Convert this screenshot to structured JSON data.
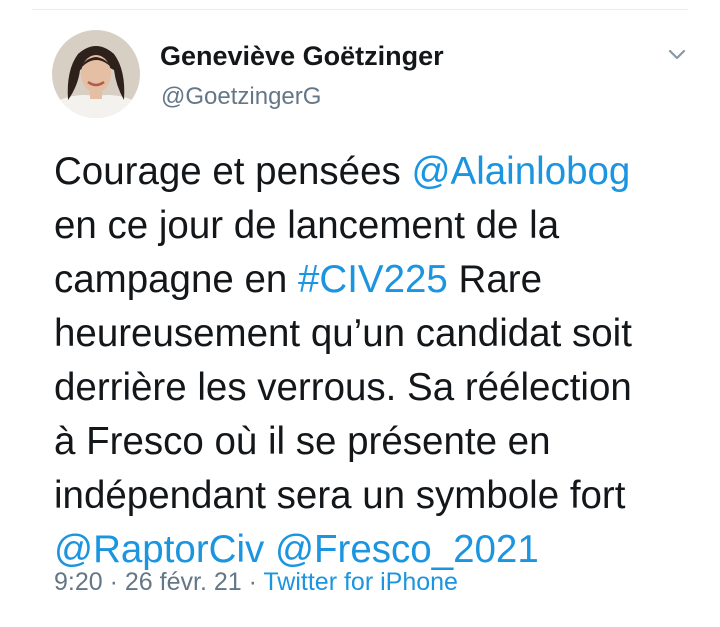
{
  "author": {
    "display_name": "Geneviève Goëtzinger",
    "handle": "@GoetzingerG"
  },
  "tweet": {
    "line1": {
      "text": "Courage et pensées ",
      "mention": "@Alainlobog"
    },
    "line2": {
      "text": "en ce jour de lancement de la"
    },
    "line3": {
      "text_before": "campagne en ",
      "hashtag": "#CIV225",
      "text_after": " Rare"
    },
    "line4": {
      "text": "heureusement qu’un candidat soit"
    },
    "line5": {
      "text": "derrière les verrous. Sa réélection"
    },
    "line6": {
      "text": "à Fresco où il se présente en"
    },
    "line7": {
      "text": "indépendant sera un symbole fort"
    },
    "line8": {
      "mention1": "@RaptorCiv",
      "space": " ",
      "mention2": "@Fresco_2021"
    }
  },
  "meta": {
    "time": "9:20",
    "sep1": " · ",
    "date": "26 févr. 21",
    "sep2": " · ",
    "source": "Twitter for iPhone"
  },
  "colors": {
    "link": "#1b95e0",
    "secondary_text": "#657786",
    "primary_text": "#14171a"
  },
  "icons": {
    "menu": "chevron-down-icon"
  }
}
